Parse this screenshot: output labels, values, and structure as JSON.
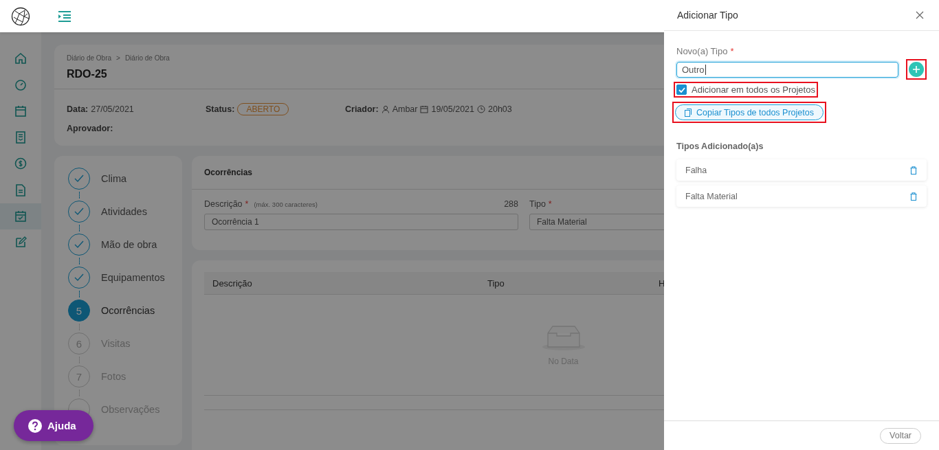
{
  "sidebar": {
    "items": [
      {
        "selected": false
      },
      {
        "selected": false
      },
      {
        "selected": false
      },
      {
        "selected": false
      },
      {
        "selected": false
      },
      {
        "selected": false
      },
      {
        "selected": true
      },
      {
        "selected": false
      }
    ]
  },
  "header": {
    "breadcrumb": [
      "Diário de Obra",
      "Diário de Obra"
    ],
    "breadcrumb_separator": ">",
    "title": "RDO-25",
    "data_label": "Data:",
    "data_value": "27/05/2021",
    "status_label": "Status:",
    "status_value": "ABERTO",
    "creator_label": "Criador:",
    "creator_name": "Ambar",
    "creator_date": "19/05/2021",
    "creator_time": "20h03",
    "approver_label": "Aprovador:"
  },
  "steps": [
    {
      "kind": "done",
      "label": "Clima"
    },
    {
      "kind": "done",
      "label": "Atividades"
    },
    {
      "kind": "done",
      "label": "Mão de obra"
    },
    {
      "kind": "done",
      "label": "Equipamentos"
    },
    {
      "kind": "current",
      "number": "5",
      "label": "Ocorrências"
    },
    {
      "kind": "pending",
      "number": "6",
      "label": "Visitas"
    },
    {
      "kind": "pending",
      "number": "7",
      "label": "Fotos"
    },
    {
      "kind": "pending",
      "label": "Observações"
    }
  ],
  "form": {
    "title": "Ocorrências",
    "description_label": "Descrição",
    "description_required": "*",
    "description_hint": "(máx. 300 caracteres)",
    "description_counter": "288",
    "description_value": "Ocorrência 1",
    "type_label": "Tipo",
    "type_required": "*",
    "type_value": "Falta Material"
  },
  "table": {
    "columns": [
      "Descrição",
      "Tipo",
      "H"
    ],
    "empty_text": "No Data"
  },
  "drawer": {
    "title": "Adicionar Tipo",
    "field_label": "Novo(a) Tipo",
    "field_required": "*",
    "field_value": "Outro",
    "add_button": {
      "highlighted": true
    },
    "all_projects": {
      "label": "Adicionar em todos os Projetos",
      "checked": true,
      "highlighted": true
    },
    "copy_button": {
      "label": "Copiar Tipos de todos Projetos",
      "highlighted": true
    },
    "section_title": "Tipos Adicionado(a)s",
    "items": [
      "Falha",
      "Falta Material"
    ],
    "back_button": "Voltar"
  },
  "help_button": "Ajuda"
}
